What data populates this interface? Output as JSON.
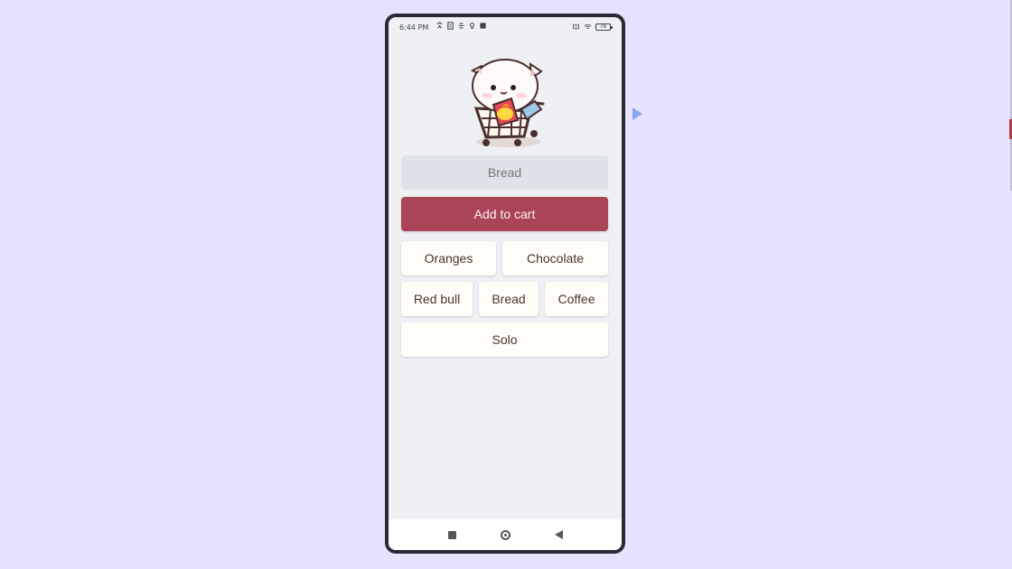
{
  "status_bar": {
    "time": "6:44 PM",
    "battery": "76"
  },
  "item_input": {
    "placeholder": "Bread"
  },
  "add_to_cart_button": {
    "label": "Add to cart"
  },
  "quick_items": [
    {
      "label": "Oranges"
    },
    {
      "label": "Chocolate"
    },
    {
      "label": "Red bull"
    },
    {
      "label": "Bread"
    },
    {
      "label": "Coffee"
    },
    {
      "label": "Solo"
    }
  ],
  "icons": {
    "mascot": "cat-shopping-cart-icon",
    "recent_apps": "square-icon",
    "home": "circle-home-icon",
    "back": "triangle-back-icon"
  },
  "colors": {
    "primary": "#aa4558",
    "input_background": "#dee3ea",
    "chip_background": "#fffdf7",
    "screen_background": "#eef0f4",
    "desktop_background": "#e8e2ff"
  }
}
